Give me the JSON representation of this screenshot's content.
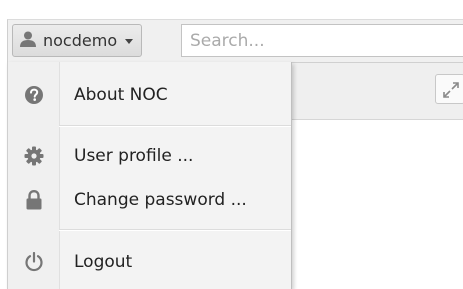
{
  "toolbar": {
    "user_button": {
      "label": "nocdemo",
      "icon": "user-icon"
    },
    "search": {
      "placeholder": "Search...",
      "value": ""
    },
    "expand_icon": "expand-icon"
  },
  "user_menu": {
    "items": [
      {
        "label": "About NOC",
        "icon": "question-circle-icon"
      },
      {
        "label": "User profile ...",
        "icon": "gear-icon"
      },
      {
        "label": "Change password ...",
        "icon": "lock-icon"
      },
      {
        "label": "Logout",
        "icon": "power-icon"
      }
    ]
  },
  "colors": {
    "icon_gray": "#7a7a7a",
    "menu_bg": "#f3f3f3",
    "toolbar_bg": "#f0f0f0"
  }
}
